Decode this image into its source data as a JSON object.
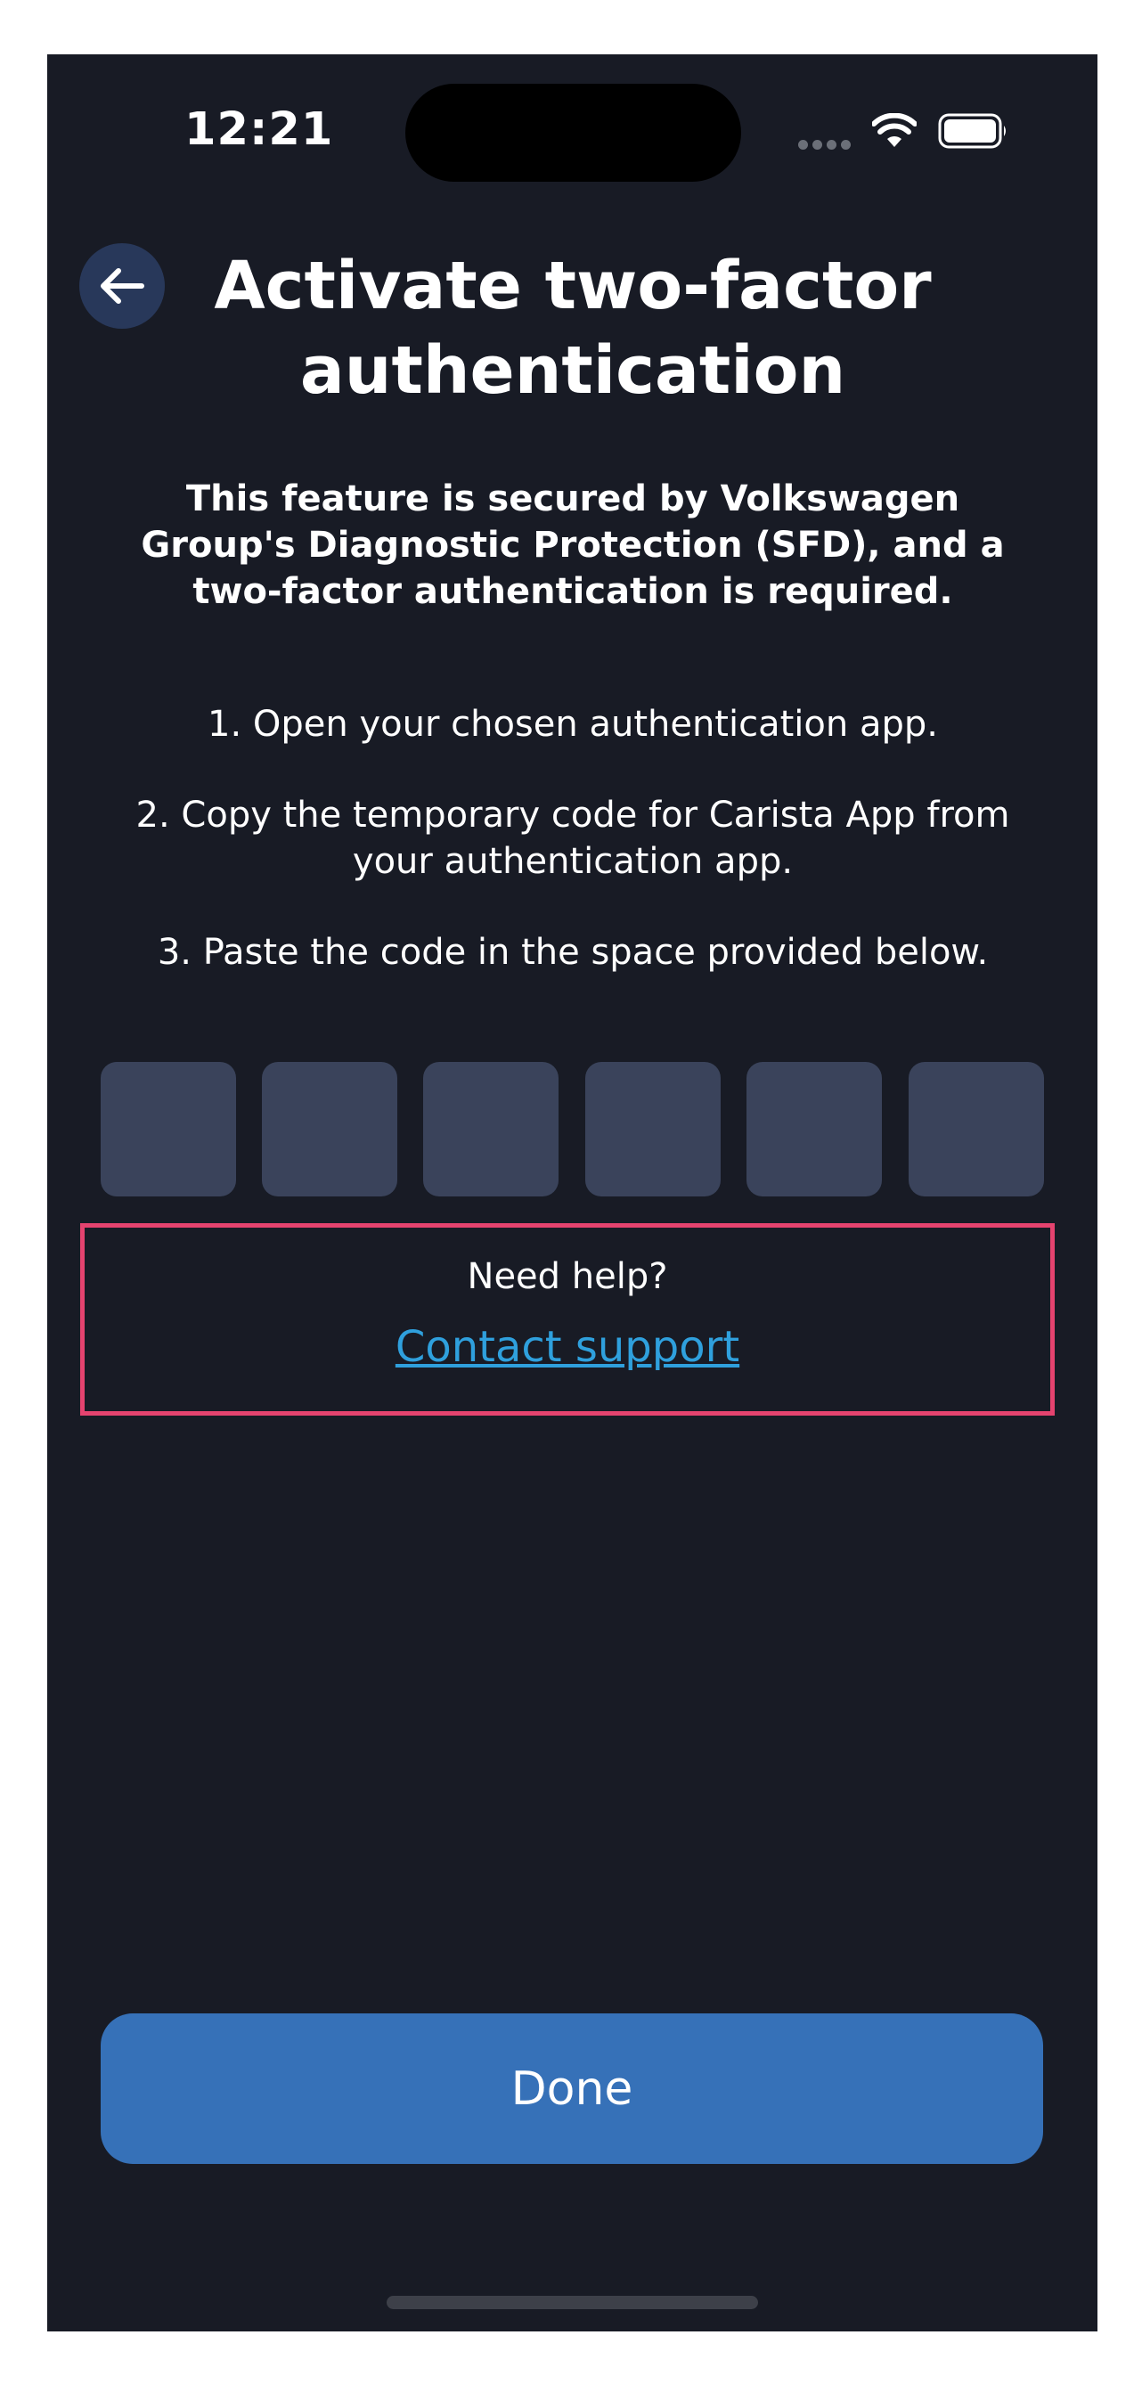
{
  "status_bar": {
    "time": "12:21"
  },
  "header": {
    "back_icon": "arrow-left-icon",
    "title": "Activate two-factor authentication"
  },
  "intro": "This feature is secured by Volkswagen Group's Diagnostic Protection (SFD), and a two-factor authentication is required.",
  "steps": [
    "1. Open your chosen authentication app.",
    "2. Copy the temporary code for Carista App from your authentication app.",
    "3. Paste the code in the space provided below."
  ],
  "code_boxes": [
    "",
    "",
    "",
    "",
    "",
    ""
  ],
  "help": {
    "question": "Need help?",
    "link": "Contact support"
  },
  "done_button": "Done",
  "colors": {
    "background": "#181b25",
    "back_button": "#28385a",
    "code_box": "#3a435b",
    "link": "#2fa0dd",
    "highlight_border": "#e5436f",
    "primary_button": "#3671b8"
  }
}
